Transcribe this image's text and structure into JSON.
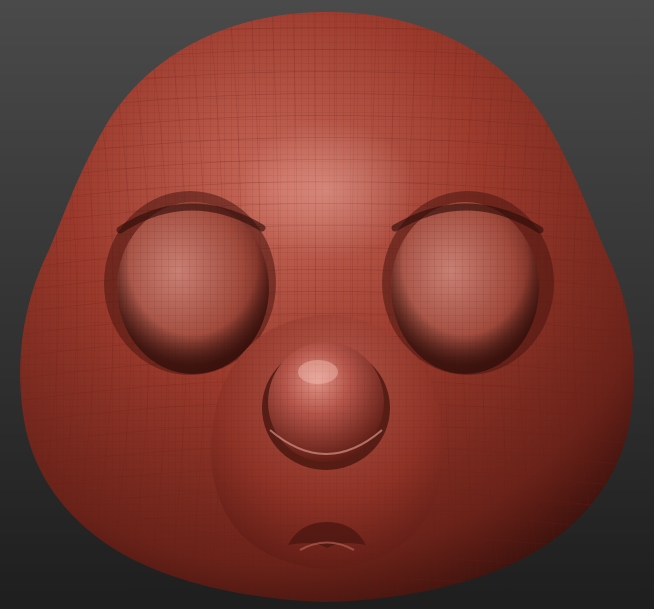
{
  "viewport": {
    "background_top": "#4a4a4a",
    "background_bottom": "#1e1e1e"
  },
  "model": {
    "subject": "sculpted-head-mesh",
    "material_color": "#9b3a2c",
    "highlight_color": "#d98a7c",
    "shadow_color": "#4a1510",
    "wire_color": "#6e2219"
  }
}
